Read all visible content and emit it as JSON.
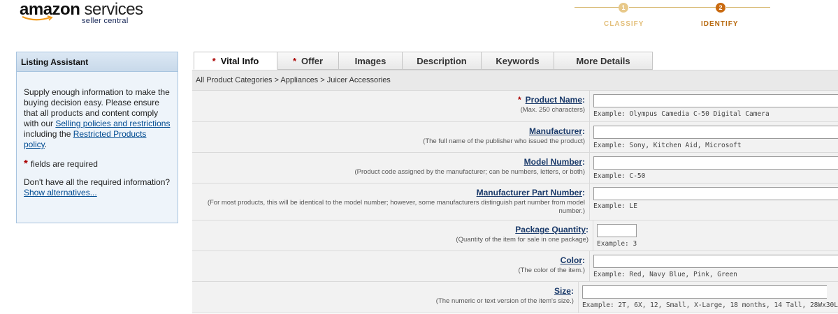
{
  "header": {
    "brand_a": "amazon",
    "brand_b": "services",
    "subtitle": "seller central"
  },
  "steps": [
    {
      "number": "1",
      "label": "CLASSIFY",
      "state": "done",
      "color": "#e8c98a"
    },
    {
      "number": "2",
      "label": "IDENTIFY",
      "state": "current",
      "color": "#c96a10"
    }
  ],
  "assistant": {
    "title": "Listing Assistant",
    "intro_1": "Supply enough information to make the buying decision easy. Please ensure that all products and content comply with our ",
    "link_selling": "Selling policies and restrictions",
    "intro_2": " including the ",
    "link_restricted": "Restricted Products policy",
    "intro_3": ".",
    "required_star": "*",
    "required_text": "fields are required",
    "alt_text": "Don't have all the required information?",
    "alt_link": "Show alternatives..."
  },
  "tabs": [
    {
      "label": "Vital Info",
      "required": true,
      "active": true
    },
    {
      "label": "Offer",
      "required": true,
      "active": false
    },
    {
      "label": "Images",
      "required": false,
      "active": false
    },
    {
      "label": "Description",
      "required": false,
      "active": false
    },
    {
      "label": "Keywords",
      "required": false,
      "active": false
    },
    {
      "label": "More Details",
      "required": false,
      "active": false
    }
  ],
  "breadcrumb": "All Product Categories > Appliances > Juicer Accessories",
  "fields": [
    {
      "name": "Product Name",
      "required": true,
      "desc": "(Max. 250 characters)",
      "value": "",
      "example": "Example:  Olympus Camedia C-50 Digital Camera"
    },
    {
      "name": "Manufacturer",
      "required": false,
      "desc": "(The full name of the publisher who issued the product)",
      "value": "",
      "example": "Example:  Sony, Kitchen Aid, Microsoft"
    },
    {
      "name": "Model Number",
      "required": false,
      "desc": "(Product code assigned by the manufacturer; can be numbers, letters, or both)",
      "value": "",
      "example": "Example:  C-50"
    },
    {
      "name": "Manufacturer Part Number",
      "required": false,
      "desc": "(For most products, this will be identical to the model number; however, some manufacturers distinguish part number from model number.)",
      "value": "",
      "example": "Example:  LE"
    },
    {
      "name": "Package Quantity",
      "required": false,
      "desc": "(Quantity of the item for sale in one package)",
      "value": "",
      "example": "Example:  3"
    },
    {
      "name": "Color",
      "required": false,
      "desc": "(The color of the item.)",
      "value": "",
      "example": "Example:  Red, Navy Blue, Pink, Green"
    },
    {
      "name": "Size",
      "required": false,
      "desc": "(The numeric or text version of the item's size.)",
      "value": "",
      "example": "Example:  2T, 6X, 12, Small, X-Large, 18 months, 14 Tall, 28Wx30L"
    }
  ],
  "colors": {
    "required_star": "#aa0000",
    "link": "#004b91",
    "field_label": "#1a3a6a"
  }
}
